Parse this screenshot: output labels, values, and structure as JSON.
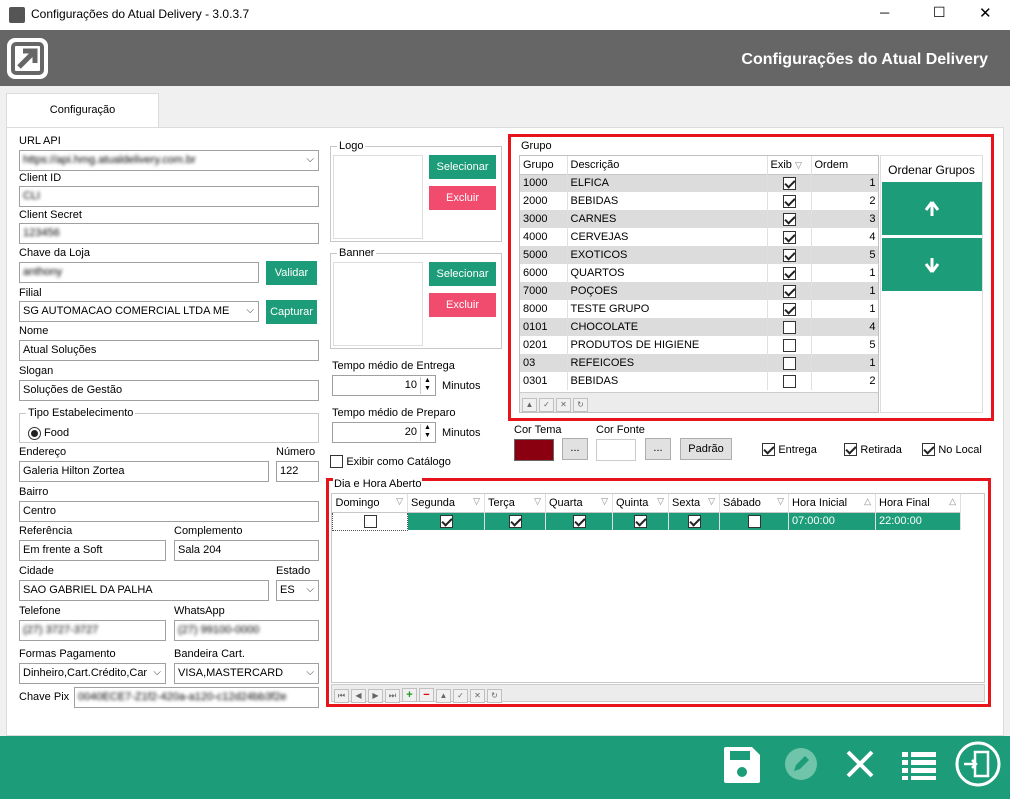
{
  "window": {
    "title": "Configurações do Atual Delivery - 3.0.3.7",
    "minimize": "─",
    "maximize": "☐",
    "close": "✕"
  },
  "header": {
    "title": "Configurações do Atual Delivery"
  },
  "tab": {
    "label": "Configuração"
  },
  "fields": {
    "url_api": {
      "label": "URL API",
      "value": "https://api.hmg.atualdelivery.com.br"
    },
    "client_id": {
      "label": "Client ID",
      "value": "CLI"
    },
    "client_secret": {
      "label": "Client Secret",
      "value": "123456"
    },
    "chave_loja": {
      "label": "Chave da Loja",
      "value": "anthony",
      "button": "Validar"
    },
    "filial": {
      "label": "Filial",
      "value": "SG AUTOMACAO COMERCIAL LTDA ME",
      "button": "Capturar"
    },
    "nome": {
      "label": "Nome",
      "value": "Atual Soluções"
    },
    "slogan": {
      "label": "Slogan",
      "value": "Soluções de Gestão"
    },
    "tipo": {
      "label": "Tipo Estabelecimento",
      "option": "Food"
    },
    "endereco": {
      "label": "Endereço",
      "value": "Galeria Hilton Zortea"
    },
    "numero": {
      "label": "Número",
      "value": "122"
    },
    "bairro": {
      "label": "Bairro",
      "value": "Centro"
    },
    "referencia": {
      "label": "Referência",
      "value": "Em frente a Soft"
    },
    "complemento": {
      "label": "Complemento",
      "value": "Sala 204"
    },
    "cidade": {
      "label": "Cidade",
      "value": "SAO GABRIEL DA PALHA"
    },
    "estado": {
      "label": "Estado",
      "value": "ES"
    },
    "telefone": {
      "label": "Telefone",
      "value": "(27) 3727-3727"
    },
    "whatsapp": {
      "label": "WhatsApp",
      "value": "(27) 99100-0000"
    },
    "formas": {
      "label": "Formas Pagamento",
      "value": "Dinheiro,Cart.Crédito,Car"
    },
    "bandeira": {
      "label": "Bandeira Cart.",
      "value": "VISA,MASTERCARD"
    },
    "chave_pix": {
      "label": "Chave Pix",
      "value": "0040ECE7-Z1f2-420a-a120-c12d24bb3f2e"
    }
  },
  "logo": {
    "label": "Logo",
    "select": "Selecionar",
    "delete": "Excluir"
  },
  "banner": {
    "label": "Banner",
    "select": "Selecionar",
    "delete": "Excluir"
  },
  "entrega": {
    "label": "Tempo médio de Entrega",
    "value": "10",
    "unit": "Minutos"
  },
  "preparo": {
    "label": "Tempo médio de Preparo",
    "value": "20",
    "unit": "Minutos"
  },
  "catalogo": {
    "label": "Exibir como Catálogo"
  },
  "cores": {
    "tema_label": "Cor Tema",
    "tema_color": "#8b0010",
    "fonte_label": "Cor Fonte",
    "ellipsis": "...",
    "padrao": "Padrão"
  },
  "opcoes": {
    "entrega": "Entrega",
    "retirada": "Retirada",
    "nolocal": "No Local"
  },
  "grupo": {
    "label": "Grupo",
    "headers": [
      "Grupo",
      "Descrição",
      "Exib",
      "Ordem"
    ],
    "rows": [
      {
        "grupo": "1000",
        "desc": "ELFICA",
        "exib": true,
        "ordem": "1"
      },
      {
        "grupo": "2000",
        "desc": "BEBIDAS",
        "exib": true,
        "ordem": "2"
      },
      {
        "grupo": "3000",
        "desc": "CARNES",
        "exib": true,
        "ordem": "3"
      },
      {
        "grupo": "4000",
        "desc": "CERVEJAS",
        "exib": true,
        "ordem": "4"
      },
      {
        "grupo": "5000",
        "desc": "EXOTICOS",
        "exib": true,
        "ordem": "5"
      },
      {
        "grupo": "6000",
        "desc": "QUARTOS",
        "exib": true,
        "ordem": "1"
      },
      {
        "grupo": "7000",
        "desc": "POÇOES",
        "exib": true,
        "ordem": "1"
      },
      {
        "grupo": "8000",
        "desc": "TESTE GRUPO",
        "exib": true,
        "ordem": "1"
      },
      {
        "grupo": "0101",
        "desc": "CHOCOLATE",
        "exib": false,
        "ordem": "4"
      },
      {
        "grupo": "0201",
        "desc": "PRODUTOS DE HIGIENE",
        "exib": false,
        "ordem": "5"
      },
      {
        "grupo": "03",
        "desc": "REFEICOES",
        "exib": false,
        "ordem": "1"
      },
      {
        "grupo": "0301",
        "desc": "BEBIDAS",
        "exib": false,
        "ordem": "2"
      }
    ],
    "ordenar_label": "Ordenar Grupos"
  },
  "horario": {
    "label": "Dia e Hora Aberto",
    "headers": [
      "Domingo",
      "Segunda",
      "Terça",
      "Quarta",
      "Quinta",
      "Sexta",
      "Sábado",
      "Hora Inicial",
      "Hora Final"
    ],
    "row": {
      "domingo": false,
      "segunda": true,
      "terca": true,
      "quarta": true,
      "quinta": true,
      "sexta": true,
      "sabado": false,
      "hora_inicial": "07:00:00",
      "hora_final": "22:00:00"
    }
  }
}
